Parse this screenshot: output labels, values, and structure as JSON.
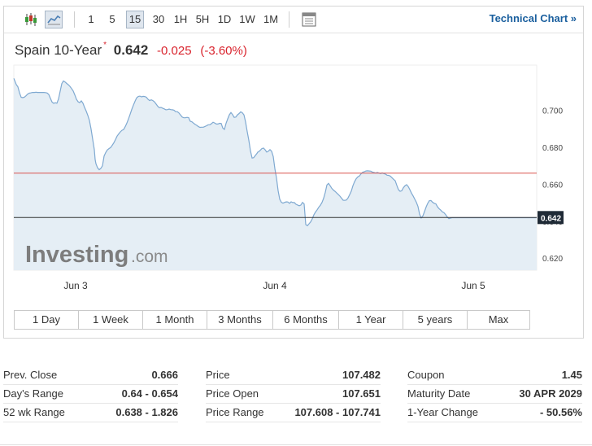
{
  "toolbar": {
    "intervals": [
      "1",
      "5",
      "15",
      "30",
      "1H",
      "5H",
      "1D",
      "1W",
      "1M"
    ],
    "active_interval": "15",
    "technical_link": "Technical Chart »"
  },
  "quote": {
    "name": "Spain 10-Year",
    "star": "*",
    "last": "0.642",
    "change": "-0.025",
    "change_pct": "(-3.60%)"
  },
  "watermark": "Investing.com",
  "ranges": [
    "1 Day",
    "1 Week",
    "1 Month",
    "3 Months",
    "6 Months",
    "1 Year",
    "5 years",
    "Max"
  ],
  "colors": {
    "line": "#7fa9d1",
    "area": "#e5eef5",
    "prev_close_line": "#d9534f",
    "current_line": "#333333",
    "negative": "#d9232d",
    "link": "#1a5f9e"
  },
  "chart_data": {
    "type": "area",
    "x_ticks": [
      "Jun 3",
      "Jun 4",
      "Jun 5"
    ],
    "y_ticks": [
      "0.620",
      "0.640",
      "0.660",
      "0.680",
      "0.700"
    ],
    "ylim": [
      0.6135,
      0.7245
    ],
    "current_label": "0.642",
    "current_value": 0.642,
    "prev_close_value": 0.666,
    "x": [
      0,
      1,
      3,
      5,
      7,
      9,
      11,
      13,
      15,
      17,
      19,
      21,
      23,
      25,
      27,
      28,
      29,
      31,
      33,
      35,
      37,
      39,
      41,
      43,
      45,
      47,
      49,
      51,
      53,
      55,
      57,
      59,
      61,
      63,
      65,
      67,
      69,
      71,
      73,
      75,
      77,
      79,
      81,
      83,
      85,
      87,
      89,
      91,
      93,
      95,
      97,
      99,
      100,
      101,
      103,
      105,
      107,
      109,
      111,
      113,
      115,
      117,
      119,
      121,
      123,
      125,
      127,
      129,
      131,
      133,
      135,
      137,
      139,
      141,
      143,
      145,
      147,
      149,
      151,
      153,
      155,
      157,
      159,
      161,
      163,
      165,
      167,
      169,
      171,
      173,
      175,
      177,
      179,
      181,
      183,
      185,
      187,
      189,
      191,
      193,
      195,
      197,
      199,
      201,
      203,
      205,
      207,
      209,
      211,
      213,
      215,
      216,
      217,
      219,
      221,
      223,
      225,
      227,
      229,
      231,
      233,
      235,
      237,
      239,
      241,
      243,
      245,
      247,
      249,
      251,
      253,
      255,
      257,
      259,
      261,
      263,
      265,
      267,
      269,
      271,
      273,
      275,
      277,
      279,
      281,
      283,
      285,
      287,
      289,
      291,
      293,
      295,
      297,
      299,
      300,
      301,
      303,
      305,
      307,
      309,
      311,
      313,
      315,
      317,
      319,
      321,
      323,
      325,
      327,
      329,
      331,
      333,
      335,
      337,
      339,
      341,
      343,
      345,
      347,
      349,
      351,
      353,
      355,
      357,
      359,
      361,
      363,
      365,
      367,
      369,
      371,
      373,
      375,
      377,
      379,
      381,
      383,
      385,
      387,
      389,
      391,
      393,
      395,
      397,
      399,
      401,
      403,
      405,
      407,
      409,
      411,
      413,
      415,
      417,
      419,
      421,
      423,
      425,
      427,
      429,
      431,
      433,
      435,
      437,
      439,
      441,
      443,
      445,
      447,
      449,
      451,
      453,
      455,
      457,
      459,
      461,
      463,
      465,
      467,
      469,
      471,
      473,
      475,
      477,
      479,
      481,
      483,
      485,
      487,
      489,
      491,
      493,
      495,
      497,
      499,
      501,
      503,
      505,
      507,
      509,
      511,
      513,
      515,
      517,
      519,
      521,
      523,
      525,
      527,
      529,
      531,
      533,
      535,
      537,
      539,
      541,
      543,
      545,
      547,
      549,
      551,
      553,
      555,
      557,
      559,
      561,
      563,
      565,
      567,
      569,
      571,
      573,
      575,
      577,
      579,
      581,
      583,
      585,
      587,
      589,
      591,
      593,
      595,
      597,
      599,
      601,
      603,
      605,
      607,
      609,
      611,
      613,
      615,
      617,
      619,
      621,
      623,
      625,
      627,
      629,
      631,
      633,
      635,
      637,
      639,
      640,
      641,
      643
    ],
    "values": [
      0.7173,
      0.7162,
      0.714,
      0.7128,
      0.7095,
      0.7071,
      0.7069,
      0.7072,
      0.7079,
      0.7088,
      0.7093,
      0.7095,
      0.7097,
      0.7097,
      0.7098,
      0.7098,
      0.7097,
      0.7097,
      0.7097,
      0.7097,
      0.7097,
      0.7096,
      0.7094,
      0.7086,
      0.7065,
      0.7045,
      0.7038,
      0.7041,
      0.7039,
      0.7062,
      0.7104,
      0.7145,
      0.7159,
      0.7154,
      0.7146,
      0.7139,
      0.713,
      0.7118,
      0.7105,
      0.7084,
      0.706,
      0.7047,
      0.7042,
      0.7051,
      0.7039,
      0.7016,
      0.6996,
      0.6973,
      0.6945,
      0.6899,
      0.6843,
      0.6787,
      0.6734,
      0.6711,
      0.6689,
      0.6679,
      0.6686,
      0.67,
      0.6753,
      0.6772,
      0.6786,
      0.6793,
      0.6799,
      0.6811,
      0.6825,
      0.6842,
      0.6861,
      0.6873,
      0.6884,
      0.6892,
      0.6896,
      0.6912,
      0.6931,
      0.6954,
      0.6979,
      0.7005,
      0.7028,
      0.7049,
      0.7068,
      0.7075,
      0.7077,
      0.7073,
      0.7076,
      0.7075,
      0.7071,
      0.706,
      0.7053,
      0.7057,
      0.7053,
      0.7046,
      0.7034,
      0.7022,
      0.7014,
      0.7016,
      0.7012,
      0.7008,
      0.7003,
      0.7004,
      0.7007,
      0.7004,
      0.7003,
      0.7001,
      0.6993,
      0.6993,
      0.6986,
      0.6975,
      0.6964,
      0.696,
      0.696,
      0.6962,
      0.6961,
      0.695,
      0.6941,
      0.6938,
      0.6931,
      0.6924,
      0.6919,
      0.6912,
      0.6908,
      0.6909,
      0.6909,
      0.6913,
      0.6917,
      0.6922,
      0.6922,
      0.6928,
      0.6936,
      0.6932,
      0.6926,
      0.6926,
      0.693,
      0.6929,
      0.6904,
      0.6897,
      0.693,
      0.6954,
      0.6976,
      0.6988,
      0.6977,
      0.6962,
      0.6964,
      0.6976,
      0.6983,
      0.6992,
      0.6987,
      0.6976,
      0.6937,
      0.6885,
      0.6838,
      0.6781,
      0.6742,
      0.6744,
      0.6756,
      0.6767,
      0.6774,
      0.6776,
      0.6784,
      0.6793,
      0.6796,
      0.6787,
      0.6774,
      0.6779,
      0.6788,
      0.6779,
      0.6751,
      0.6685,
      0.6634,
      0.6566,
      0.6519,
      0.6503,
      0.6498,
      0.6502,
      0.6505,
      0.6504,
      0.6497,
      0.6505,
      0.6501,
      0.6501,
      0.6492,
      0.6488,
      0.6484,
      0.6488,
      0.6502,
      0.6494,
      0.6382,
      0.6376,
      0.6386,
      0.6396,
      0.6413,
      0.6435,
      0.645,
      0.6462,
      0.6476,
      0.6487,
      0.6502,
      0.6525,
      0.6556,
      0.6596,
      0.6605,
      0.6592,
      0.6578,
      0.6569,
      0.6562,
      0.6553,
      0.6545,
      0.6536,
      0.6525,
      0.6514,
      0.6513,
      0.6515,
      0.6526,
      0.6544,
      0.6563,
      0.6592,
      0.6614,
      0.663,
      0.664,
      0.6645,
      0.6657,
      0.6665,
      0.6668,
      0.6672,
      0.6673,
      0.6672,
      0.6671,
      0.6666,
      0.6664,
      0.6661,
      0.6664,
      0.6661,
      0.6658,
      0.6662,
      0.6658,
      0.6655,
      0.6649,
      0.6648,
      0.6644,
      0.6636,
      0.6627,
      0.6619,
      0.6594,
      0.6571,
      0.6562,
      0.6565,
      0.6581,
      0.6592,
      0.6598,
      0.6588,
      0.6571,
      0.6552,
      0.6537,
      0.652,
      0.6503,
      0.648,
      0.6438,
      0.6418,
      0.6429,
      0.6452,
      0.6477,
      0.6497,
      0.6511,
      0.6512,
      0.6503,
      0.6497,
      0.6494,
      0.6478,
      0.6468,
      0.646,
      0.6451,
      0.6446,
      0.6436,
      0.6423,
      0.6414,
      0.6417,
      0.6419,
      0.6419,
      0.6419,
      0.6419,
      0.6419,
      0.6419,
      0.6419,
      0.6419,
      0.6419,
      0.6419,
      0.6419,
      0.6419,
      0.6419,
      0.6419,
      0.6419,
      0.6419,
      0.6419,
      0.6419,
      0.6419,
      0.6419,
      0.6419,
      0.6419,
      0.6419,
      0.6419,
      0.6419,
      0.6419,
      0.6419,
      0.6419,
      0.6419,
      0.6419,
      0.6419,
      0.6419,
      0.6419,
      0.6419,
      0.6419,
      0.6419,
      0.6419,
      0.6419,
      0.6419,
      0.6419,
      0.6419,
      0.6419,
      0.6419,
      0.6419,
      0.6419,
      0.6419,
      0.6419,
      0.6419,
      0.6419,
      0.6419,
      0.6419,
      0.6419,
      0.6419,
      0.6419,
      0.6419,
      0.6419,
      0.6419,
      0.6419,
      0.6419,
      0.6419,
      0.6419,
      0.6419,
      0.6419,
      0.6419,
      0.6419,
      0.6419,
      0.6419,
      0.6419,
      0.6419,
      0.6419,
      0.6419,
      0.6419,
      0.6419,
      0.6419,
      0.6419,
      0.6419,
      0.6419,
      0.6419,
      0.6419,
      0.6419,
      0.6419,
      0.6419,
      0.6419,
      0.6419,
      0.6419,
      0.6419,
      0.6419,
      0.6419,
      0.6419
    ]
  },
  "stats": {
    "col1": [
      {
        "label": "Prev. Close",
        "value": "0.666"
      },
      {
        "label": "Day's Range",
        "value": "0.64 - 0.654"
      },
      {
        "label": "52 wk Range",
        "value": "0.638 - 1.826"
      }
    ],
    "col2": [
      {
        "label": "Price",
        "value": "107.482"
      },
      {
        "label": "Price Open",
        "value": "107.651"
      },
      {
        "label": "Price Range",
        "value": "107.608 - 107.741"
      }
    ],
    "col3": [
      {
        "label": "Coupon",
        "value": "1.45"
      },
      {
        "label": "Maturity Date",
        "value": "30 APR 2029"
      },
      {
        "label": "1-Year Change",
        "value": "- 50.56%"
      }
    ]
  }
}
